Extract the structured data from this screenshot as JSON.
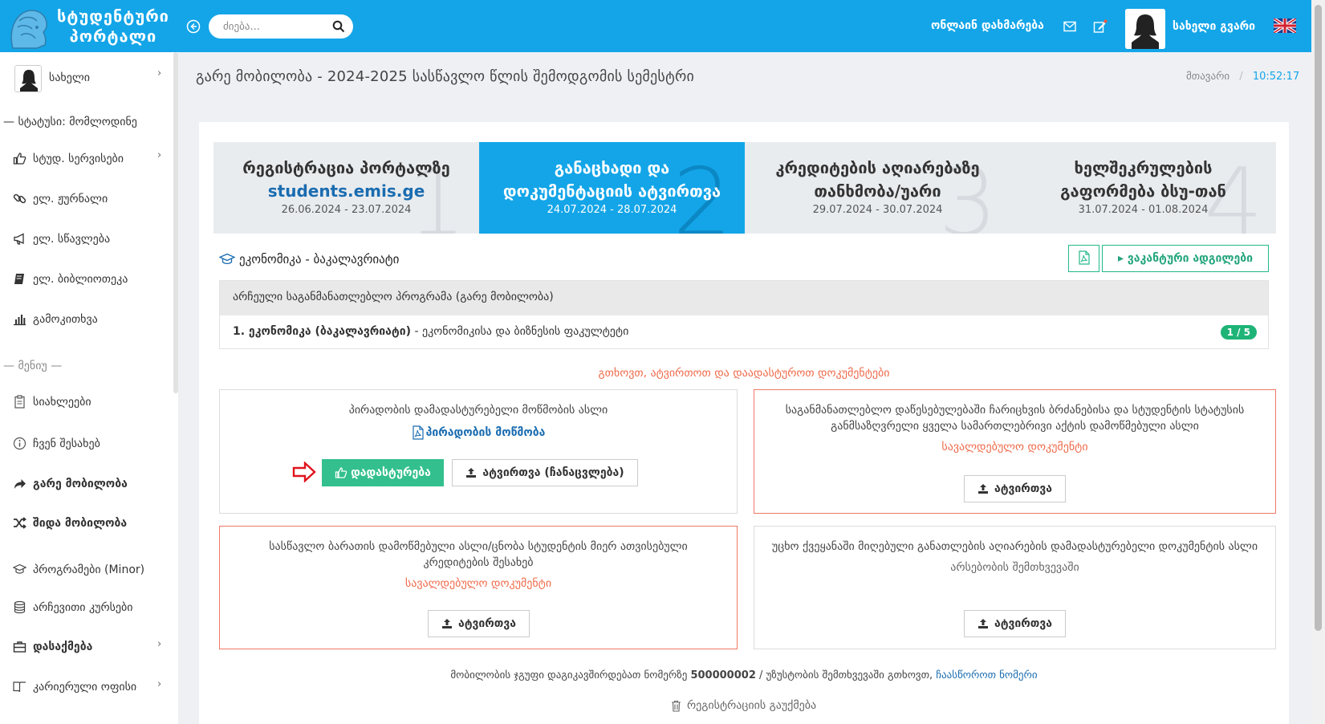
{
  "header": {
    "logo_text": "სტუდენტური პორტალი",
    "search_placeholder": "ძიება...",
    "help": "ონლაინ დახმარება",
    "username": "სახელი გვარი",
    "icons": [
      "back-icon",
      "search-icon",
      "mail-icon",
      "edit-icon",
      "user-avatar",
      "flag-uk-icon"
    ]
  },
  "sidebar": {
    "profile_name": "სახელი",
    "status": "— სტატუსი: მომლოდინე",
    "items": [
      {
        "label": "სტუდ. სერვისები",
        "icon": "thumbs-up-icon",
        "chevron": true
      },
      {
        "label": "ელ. ჟურნალი",
        "icon": "link-icon"
      },
      {
        "label": "ელ. სწავლება",
        "icon": "megaphone-icon"
      },
      {
        "label": "ელ. ბიბლიოთეკა",
        "icon": "book-icon"
      },
      {
        "label": "გამოკითხვა",
        "icon": "bar-chart-icon"
      }
    ],
    "menu_header": "— მენიუ —",
    "menu": [
      {
        "label": "სიახლეები",
        "icon": "clipboard-icon"
      },
      {
        "label": "ჩვენ შესახებ",
        "icon": "info-icon"
      },
      {
        "label": "გარე მობილობა",
        "icon": "share-icon"
      },
      {
        "label": "შიდა მობილობა",
        "icon": "shuffle-icon"
      },
      {
        "label": "პროგრამები (Minor)",
        "icon": "graduation-cap-icon"
      },
      {
        "label": "არჩევითი კურსები",
        "icon": "database-icon"
      },
      {
        "label": "დასაქმება",
        "icon": "briefcase-icon",
        "chevron": true
      },
      {
        "label": "კარიერული ოფისი",
        "icon": "book-open-icon",
        "chevron": true
      }
    ]
  },
  "page": {
    "title": "გარე მობილობა - 2024-2025 სასწავლო წლის შემოდგომის სემესტრი",
    "breadcrumb_home": "მთავარი",
    "breadcrumb_sep": "/",
    "time": "10:52:17"
  },
  "steps": [
    {
      "number": "1",
      "title": "რეგისტრაცია პორტალზე",
      "title2": "students.emis.ge",
      "dates": "26.06.2024 - 23.07.2024",
      "active": false
    },
    {
      "number": "2",
      "title": "განაცხადი და დოკუმენტაციის ატვირთვა",
      "dates": "24.07.2024 - 28.07.2024",
      "active": true
    },
    {
      "number": "3",
      "title": "კრედიტების აღიარებაზე თანხმობა/უარი",
      "dates": "29.07.2024 - 30.07.2024",
      "active": false
    },
    {
      "number": "4",
      "title": "ხელშეკრულების გაფორმება ბსუ-თან",
      "dates": "31.07.2024 - 01.08.2024",
      "active": false
    }
  ],
  "program": {
    "name": "ეკონომიკა - ბაკალავრიატი",
    "vacancies_button": "ვაკანტური ადგილები",
    "table_header": "არჩეული საგანმანათლებლო პროგრამა (გარე მობილობა)",
    "row_bold": "1. ეკონომიკა (ბაკალავრიატი)",
    "row_rest": " - ეკონომიკისა და ბიზნესის ფაკულტეტი",
    "badge": "1 / 5"
  },
  "notice": "გთხოვთ, ატვირთოთ და დაადასტუროთ დოკუმენტები",
  "cards": {
    "id": {
      "title": "პირადობის დამადასტურებელი მოწმობის ასლი",
      "link": "პირადობის მოწმობა",
      "confirm": "დადასტურება",
      "replace": "ატვირთვა (ჩანაცვლება)"
    },
    "order": {
      "title": "საგანმანათლებლო დაწესებულებაში ჩარიცხვის ბრძანებისა და სტუდენტის სტატუსის განმსაზღვრელი ყველა სამართლებრივი აქტის დამოწმებული ასლი",
      "tag": "სავალდებულო დოკუმენტი",
      "upload": "ატვირთვა"
    },
    "credits": {
      "title": "სასწავლო ბარათის დამოწმებული ასლი/ცნობა სტუდენტის მიერ ათვისებული კრედიტების შესახებ",
      "tag": "სავალდებულო დოკუმენტი",
      "upload": "ატვირთვა"
    },
    "foreign": {
      "title": "უცხო ქვეყანაში მიღებული განათლების აღიარების დამადასტურებელი დოკუმენტის ასლი",
      "tag": "არსებობის შემთხვევაში",
      "upload": "ატვირთვა"
    }
  },
  "footer": {
    "text1": "მობილობის ჯგუფი დაგიკავშირდებათ ნომერზე ",
    "phone": "500000002",
    "text2": " / უზუსტობის შემთხვევაში გთხოვთ, ",
    "link": "ჩაასწოროთ ნომერი",
    "cancel": "რეგისტრაციის გაუქმება"
  },
  "colors": {
    "primary": "#13a5e8",
    "active_step_number": "#0b87c4",
    "green": "#33c08e",
    "required": "#ef6a4a",
    "link": "#1a6cb0"
  }
}
